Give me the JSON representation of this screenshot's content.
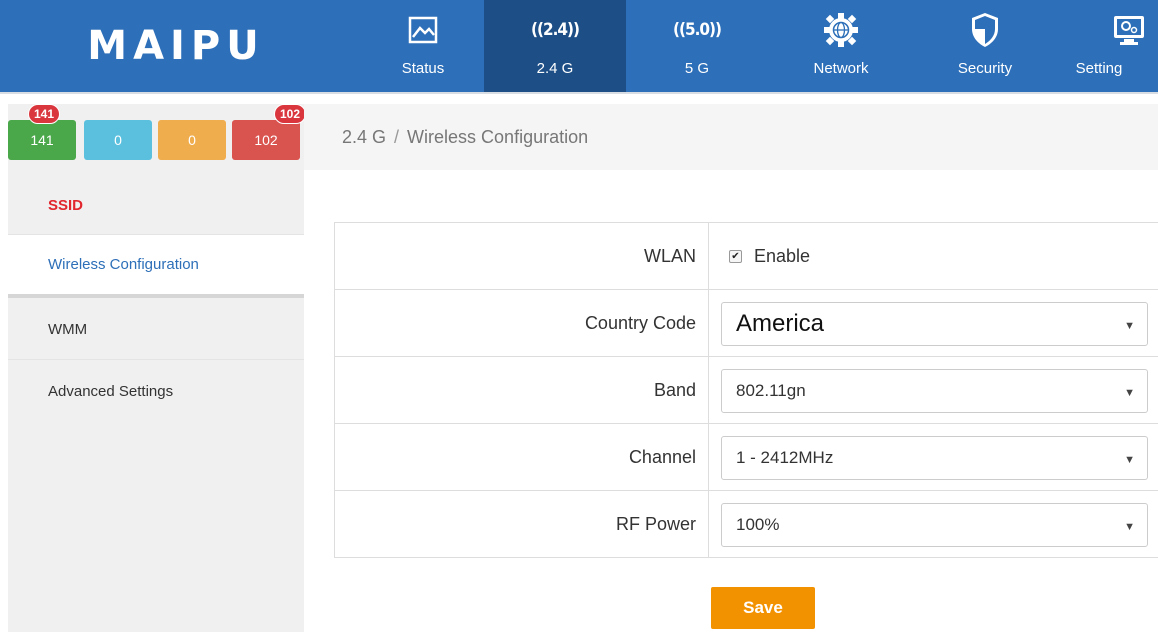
{
  "brand": {
    "logo_text": "MAIPU"
  },
  "nav": {
    "items": [
      {
        "label": "Status",
        "icon": "image-icon"
      },
      {
        "label": "2.4 G",
        "icon": "wifi-24-icon",
        "badge": "((2.4))",
        "active": true
      },
      {
        "label": "5 G",
        "icon": "wifi-5-icon",
        "badge": "((5.0))"
      },
      {
        "label": "Network",
        "icon": "globe-gear-icon"
      },
      {
        "label": "Security",
        "icon": "shield-icon"
      },
      {
        "label": "Setting",
        "icon": "monitor-settings-icon"
      }
    ]
  },
  "counts": {
    "items": [
      {
        "value": "141",
        "color": "#4aa84a",
        "bubble": "141"
      },
      {
        "value": "0",
        "color": "#5bc0de"
      },
      {
        "value": "0",
        "color": "#f0ad4e"
      },
      {
        "value": "102",
        "color": "#d9534f",
        "bubble": "102"
      }
    ]
  },
  "sidebar": {
    "items": [
      {
        "label": "SSID"
      },
      {
        "label": "Wireless Configuration",
        "active": true
      },
      {
        "label": "WMM"
      },
      {
        "label": "Advanced Settings"
      }
    ]
  },
  "breadcrumb": {
    "section": "2.4 G",
    "separator": "/",
    "page": "Wireless Configuration"
  },
  "form": {
    "wlan": {
      "label": "WLAN",
      "checkbox_label": "Enable",
      "checked": true
    },
    "country_code": {
      "label": "Country Code",
      "value": "America"
    },
    "band": {
      "label": "Band",
      "value": "802.11gn"
    },
    "channel": {
      "label": "Channel",
      "value": "1 - 2412MHz"
    },
    "rf_power": {
      "label": "RF Power",
      "value": "100%"
    }
  },
  "actions": {
    "save_label": "Save"
  },
  "colors": {
    "header": "#2d6fb8",
    "header_active": "#1d4f86",
    "accent_red": "#e1262d",
    "link_blue": "#2d6fb8",
    "save": "#f39200"
  }
}
